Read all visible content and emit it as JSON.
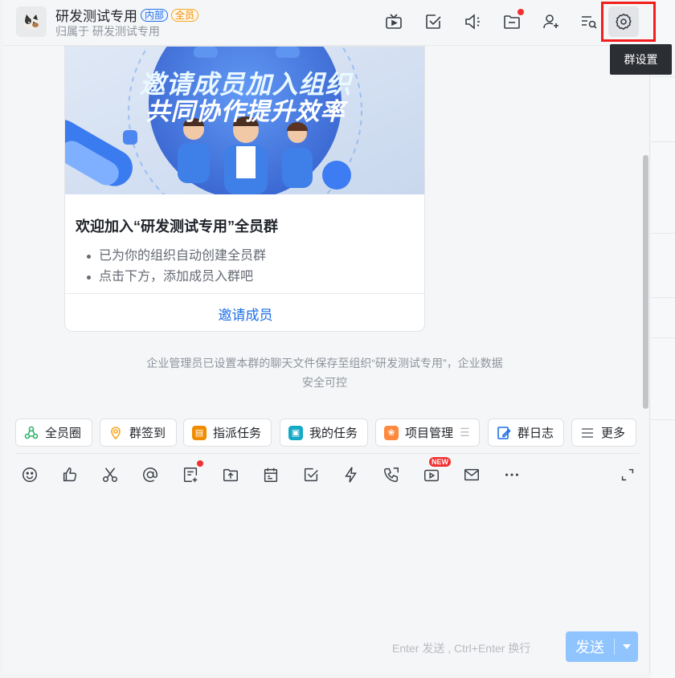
{
  "header": {
    "title": "研发测试专用",
    "tag_internal": "内部",
    "tag_all": "全员",
    "subtitle": "归属于 研发测试专用",
    "icons": [
      "tv-icon",
      "checkbox-icon",
      "announcement-icon",
      "folder-icon",
      "add-member-icon",
      "search-history-icon",
      "gear-icon"
    ]
  },
  "tooltip": {
    "text": "群设置"
  },
  "card": {
    "banner_line1": "邀请成员加入组织",
    "banner_line2": "共同协作提升效率",
    "title": "欢迎加入“研发测试专用”全员群",
    "bullets": [
      "已为你的组织自动创建全员群",
      "点击下方，添加成员入群吧"
    ],
    "invite_label": "邀请成员"
  },
  "notice": {
    "line1": "企业管理员已设置本群的聊天文件保存至组织“研发测试专用”，企业数据",
    "line2": "安全可控"
  },
  "quick_apps": [
    {
      "label": "全员圈",
      "color": "#2fb36b"
    },
    {
      "label": "群签到",
      "color": "#f5a623"
    },
    {
      "label": "指派任务",
      "color": "#f08c00"
    },
    {
      "label": "我的任务",
      "color": "#14a9c7"
    },
    {
      "label": "项目管理",
      "color": "#ff8a3d"
    },
    {
      "label": "群日志",
      "color": "#1f6fe6"
    },
    {
      "label": "更多",
      "color": "#646a73"
    }
  ],
  "toolbar": {
    "icons": [
      "emoji-icon",
      "thumbs-up-icon",
      "scissors-icon",
      "at-icon",
      "file-add-icon",
      "upload-folder-icon",
      "calendar-icon",
      "check-icon",
      "lightning-icon",
      "phone-icon",
      "video-icon",
      "mail-icon",
      "more-icon",
      "expand-icon"
    ],
    "new_badge": "NEW"
  },
  "composer": {
    "hint": "Enter 发送 , Ctrl+Enter 换行",
    "send_label": "发送"
  },
  "colors": {
    "accent": "#1f6fe6",
    "highlight": "#f21d1d",
    "send_disabled": "#8fc4ff"
  }
}
